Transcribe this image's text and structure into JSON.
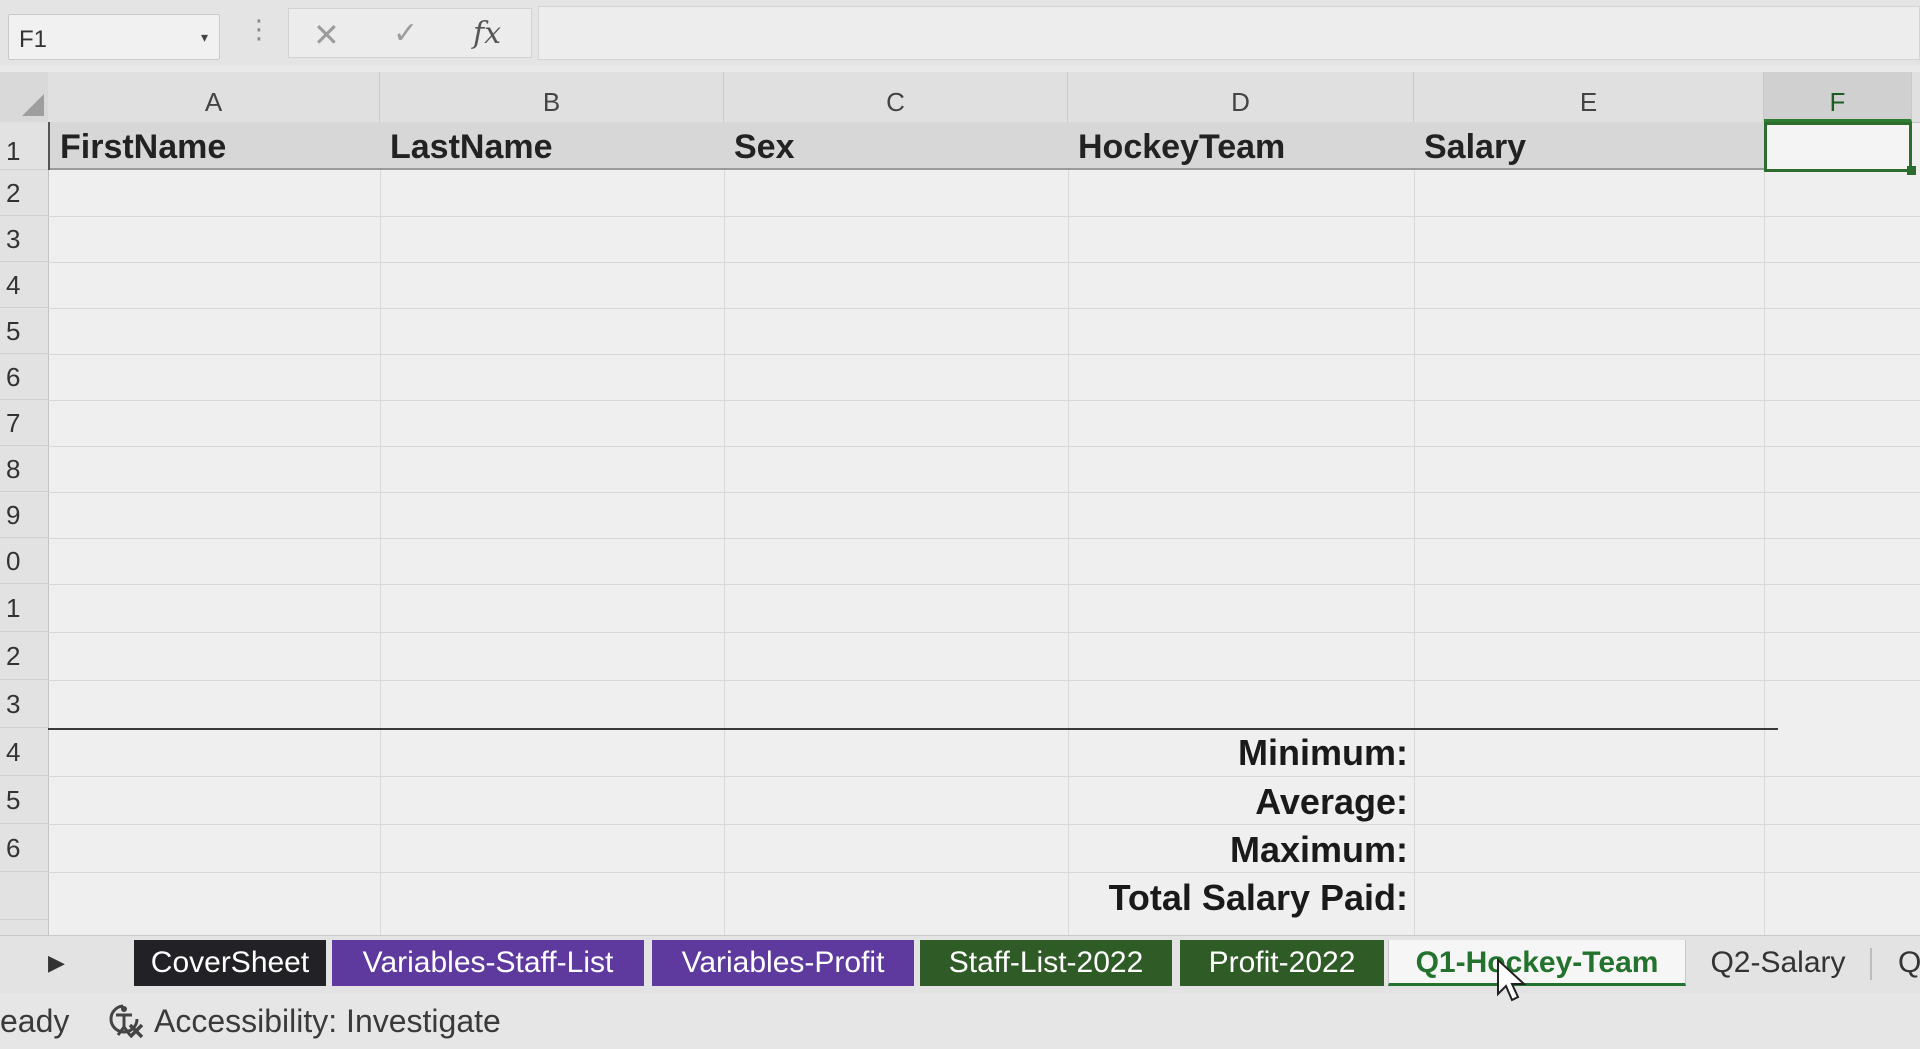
{
  "formula_bar": {
    "name_box": "F1",
    "formula_icon": "fx",
    "cancel_icon": "close-icon",
    "enter_icon": "check-icon",
    "formula_value": ""
  },
  "columns": [
    {
      "letter": "A",
      "header": "FirstName"
    },
    {
      "letter": "B",
      "header": "LastName"
    },
    {
      "letter": "C",
      "header": "Sex"
    },
    {
      "letter": "D",
      "header": "HockeyTeam"
    },
    {
      "letter": "E",
      "header": "Salary"
    },
    {
      "letter": "F",
      "header": ""
    }
  ],
  "rows": [
    "1",
    "2",
    "3",
    "4",
    "5",
    "6",
    "7",
    "8",
    "9",
    "0",
    "1",
    "2",
    "3",
    "4",
    "5",
    "6",
    ""
  ],
  "summary": {
    "minimum": "Minimum:",
    "average": "Average:",
    "maximum": "Maximum:",
    "total": "Total Salary Paid:"
  },
  "sheet_tabs": [
    {
      "label": "CoverSheet",
      "color": "#222226"
    },
    {
      "label": "Variables-Staff-List",
      "color": "#5e3a9e"
    },
    {
      "label": "Variables-Profit",
      "color": "#5e3a9e"
    },
    {
      "label": "Staff-List-2022",
      "color": "#2f5b26"
    },
    {
      "label": "Profit-2022",
      "color": "#2f5b26"
    },
    {
      "label": "Q1-Hockey-Team",
      "active": true
    },
    {
      "label": "Q2-Salary"
    },
    {
      "label": "Q"
    }
  ],
  "status_bar": {
    "ready": "eady",
    "accessibility": "Accessibility: Investigate"
  },
  "colors": {
    "accent": "#2e6b2f",
    "active_tab_text": "#23722d"
  }
}
